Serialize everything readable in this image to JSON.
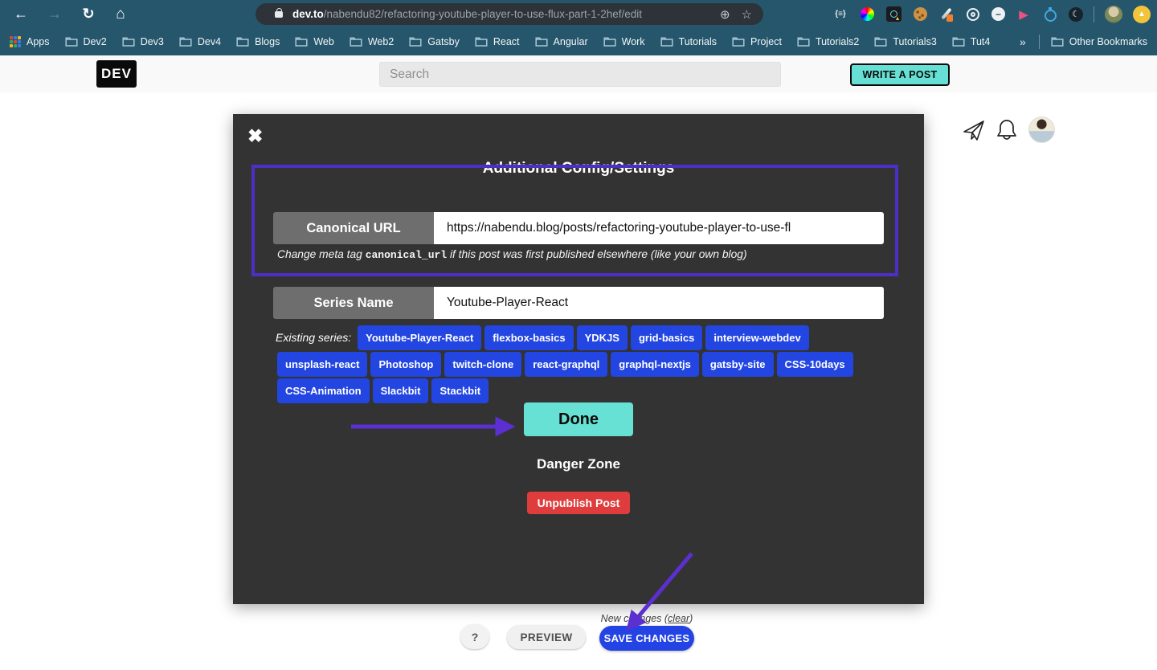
{
  "browser": {
    "back_icon": "←",
    "forward_icon": "→",
    "reload_icon": "↻",
    "home_icon": "⌂",
    "url_host": "dev.to",
    "url_path": "/nabendu82/refactoring-youtube-player-to-use-flux-part-1-2hef/edit",
    "zoom_icon": "⊕",
    "star_icon": "☆",
    "braces_icon": "{≡}",
    "play_icon": "▶",
    "moon_icon": "☾",
    "minus_icon": "−",
    "up_icon": "▲",
    "bookmarks": {
      "apps_label": "Apps",
      "folders": [
        "Dev2",
        "Dev3",
        "Dev4",
        "Blogs",
        "Web",
        "Web2",
        "Gatsby",
        "React",
        "Angular",
        "Work",
        "Tutorials",
        "Project",
        "Tutorials2",
        "Tutorials3",
        "Tut4"
      ],
      "overflow_icon": "»",
      "other_bookmarks": "Other Bookmarks"
    }
  },
  "header": {
    "logo": "DEV",
    "search_placeholder": "Search",
    "write_post_label": "WRITE A POST"
  },
  "modal": {
    "close_icon": "✖",
    "title": "Additional Config/Settings",
    "canonical": {
      "label": "Canonical URL",
      "value": "https://nabendu.blog/posts/refactoring-youtube-player-to-use-fl"
    },
    "canonical_help": {
      "prefix": "Change meta tag ",
      "code": "canonical_url",
      "suffix": " if this post was first published elsewhere (like your own blog)"
    },
    "series": {
      "label": "Series Name",
      "value": "Youtube-Player-React"
    },
    "existing_series_label": "Existing series:",
    "series_tags": [
      "Youtube-Player-React",
      "flexbox-basics",
      "YDKJS",
      "grid-basics",
      "interview-webdev",
      "unsplash-react",
      "Photoshop",
      "twitch-clone",
      "react-graphql",
      "graphql-nextjs",
      "gatsby-site",
      "CSS-10days",
      "CSS-Animation",
      "Slackbit",
      "Stackbit"
    ],
    "done_label": "Done",
    "danger_zone_title": "Danger Zone",
    "unpublish_label": "Unpublish Post"
  },
  "footer": {
    "new_changes_prefix": "New changes (",
    "clear_label": "clear",
    "new_changes_suffix": ")",
    "help_label": "?",
    "preview_label": "PREVIEW",
    "save_label": "SAVE CHANGES"
  },
  "colors": {
    "chrome_bar": "#26566c",
    "url_pill": "#2d3338",
    "modal_bg": "#333333",
    "accent_teal": "#66e0d4",
    "accent_blue": "#2346e2",
    "danger_red": "#df3d3d",
    "annotation_purple": "#4c30c6",
    "arrow_purple": "#5b2fd0",
    "label_gray": "#6e6e6e"
  }
}
